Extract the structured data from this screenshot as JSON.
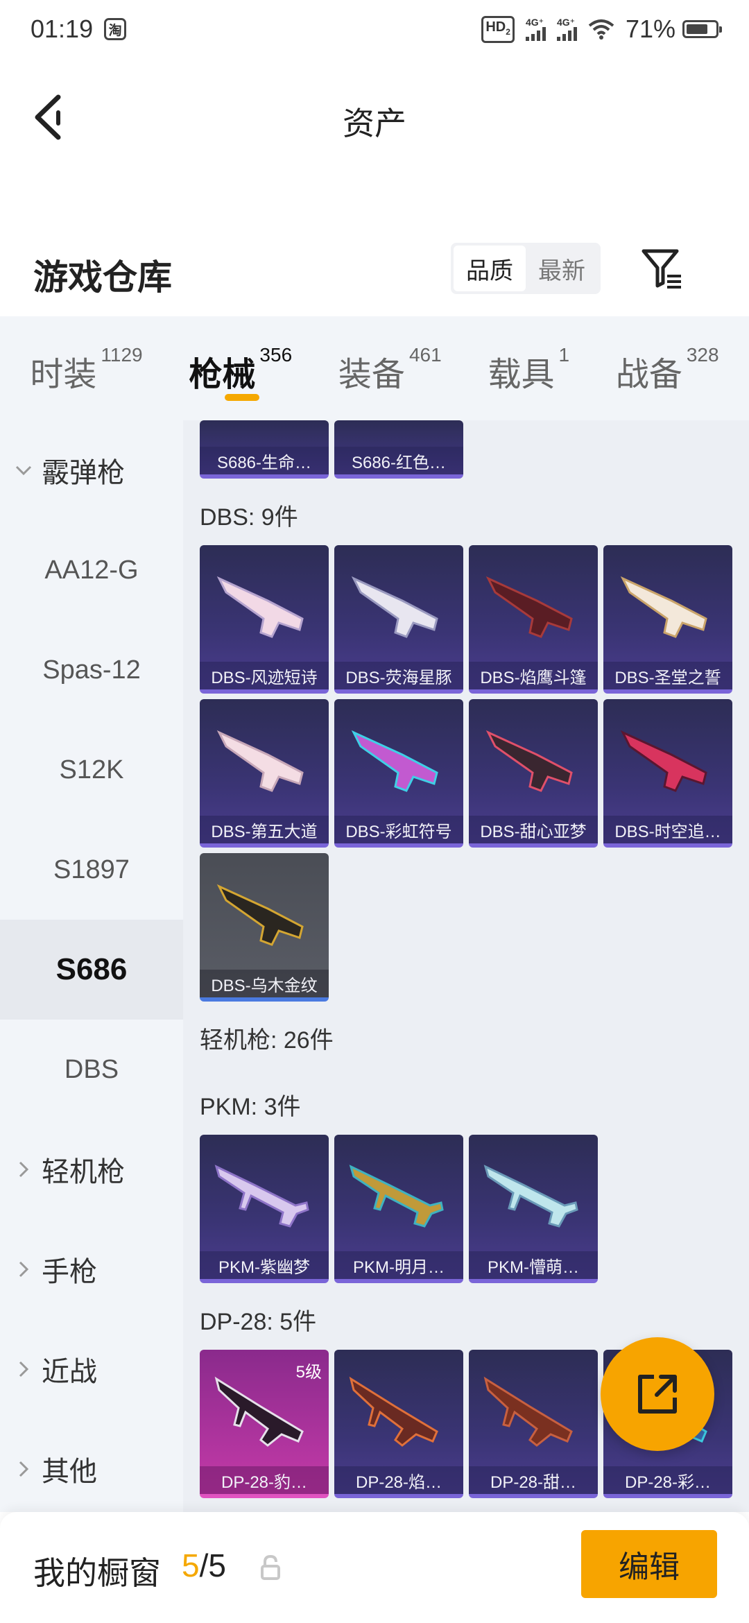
{
  "status_bar": {
    "time": "01:19",
    "app_badge": "淘",
    "hd": "HD",
    "hd_sub": "2",
    "net1": "4G⁺",
    "net2": "4G⁺",
    "battery": "71%"
  },
  "header": {
    "title": "资产"
  },
  "section": {
    "title": "游戏仓库",
    "sort_options": [
      "品质",
      "最新"
    ],
    "sort_selected": "品质"
  },
  "tabs": [
    {
      "label": "时装",
      "count": "1129"
    },
    {
      "label": "枪械",
      "count": "356"
    },
    {
      "label": "装备",
      "count": "461"
    },
    {
      "label": "载具",
      "count": "1"
    },
    {
      "label": "战备",
      "count": "328"
    }
  ],
  "sidebar": {
    "items": [
      {
        "label": "霰弹枪",
        "type": "group-open"
      },
      {
        "label": "AA12-G",
        "type": "sub"
      },
      {
        "label": "Spas-12",
        "type": "sub"
      },
      {
        "label": "S12K",
        "type": "sub"
      },
      {
        "label": "S1897",
        "type": "sub"
      },
      {
        "label": "S686",
        "type": "sub-active"
      },
      {
        "label": "DBS",
        "type": "sub"
      },
      {
        "label": "轻机枪",
        "type": "group"
      },
      {
        "label": "手枪",
        "type": "group"
      },
      {
        "label": "近战",
        "type": "group"
      },
      {
        "label": "其他",
        "type": "group"
      }
    ]
  },
  "content": {
    "s686_partial": [
      "S686-生命…",
      "S686-红色…"
    ],
    "dbs_heading": "DBS: 9件",
    "dbs_items": [
      "DBS-风迹短诗",
      "DBS-荧海星豚",
      "DBS-焰鹰斗篷",
      "DBS-圣堂之誓",
      "DBS-第五大道",
      "DBS-彩虹符号",
      "DBS-甜心亚梦",
      "DBS-时空追…",
      "DBS-乌木金纹"
    ],
    "lmg_heading": "轻机枪: 26件",
    "pkm_heading": "PKM: 3件",
    "pkm_items": [
      "PKM-紫幽梦",
      "PKM-明月…",
      "PKM-懵萌…"
    ],
    "dp28_heading": "DP-28: 5件",
    "dp28_items": [
      "DP-28-豹…",
      "DP-28-焰…",
      "DP-28-甜…",
      "DP-28-彩…"
    ],
    "dp28_first_level": "5级"
  },
  "bottom_bar": {
    "label": "我的橱窗",
    "current": "5",
    "total": "/5",
    "edit_label": "编辑"
  },
  "colors": {
    "accent": "#f7a400",
    "card_purple": "#3a3474",
    "card_gray": "#5a5d66",
    "card_pink": "#c43aa8"
  }
}
